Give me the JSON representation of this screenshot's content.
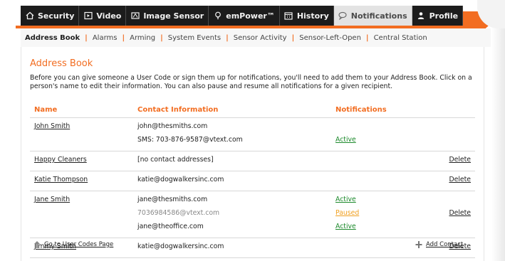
{
  "tabs": [
    {
      "label": "Security",
      "icon": "home-icon",
      "active": false
    },
    {
      "label": "Video",
      "icon": "video-icon",
      "active": false
    },
    {
      "label": "Image Sensor",
      "icon": "image-sensor-icon",
      "active": false
    },
    {
      "label": "emPower™",
      "icon": "bulb-icon",
      "active": false
    },
    {
      "label": "History",
      "icon": "calendar-icon",
      "active": false
    },
    {
      "label": "Notifications",
      "icon": "chat-bubble-icon",
      "active": true
    },
    {
      "label": "Profile",
      "icon": "person-icon",
      "active": false
    }
  ],
  "subnav": [
    {
      "label": "Address Book",
      "active": true
    },
    {
      "label": "Alarms",
      "active": false
    },
    {
      "label": "Arming",
      "active": false
    },
    {
      "label": "System Events",
      "active": false
    },
    {
      "label": "Sensor Activity",
      "active": false
    },
    {
      "label": "Sensor-Left-Open",
      "active": false
    },
    {
      "label": "Central Station",
      "active": false
    }
  ],
  "subnav_separator": "|",
  "page": {
    "title": "Address Book",
    "intro": "Before you can give someone a User Code or sign them up for notifications, you'll need to add them to your Address Book. Click on a person's name to edit their information. You can also pause and resume all notifications for a given recipient."
  },
  "table": {
    "headers": {
      "name": "Name",
      "contact": "Contact Information",
      "notifications": "Notifications"
    },
    "rows": [
      {
        "name": "John Smith",
        "contacts": [
          "john@thesmiths.com",
          "SMS: 703-876-9587@vtext.com"
        ],
        "notifications": [
          "",
          "Active"
        ],
        "delete": ""
      },
      {
        "name": "Happy Cleaners",
        "contacts": [
          "[no contact addresses]"
        ],
        "notifications": [
          ""
        ],
        "delete": "Delete"
      },
      {
        "name": "Katie Thompson",
        "contacts": [
          "katie@dogwalkersinc.com"
        ],
        "notifications": [
          ""
        ],
        "delete": "Delete"
      },
      {
        "name": "Jane Smith",
        "contacts": [
          "jane@thesmiths.com",
          "7036984586@vtext.com",
          "jane@theoffice.com"
        ],
        "notifications": [
          "Active",
          "Paused",
          "Active"
        ],
        "delete": "Delete"
      },
      {
        "name": "Jimmy Smith",
        "contacts": [
          "katie@dogwalkersinc.com"
        ],
        "notifications": [
          ""
        ],
        "delete": "Delete"
      }
    ]
  },
  "footer": {
    "go_to_user_codes": "Go to User Codes Page",
    "add_contact": "Add Contact"
  },
  "colors": {
    "accent": "#f26d21",
    "active": "#1d8a2c",
    "paused": "#f0a020",
    "tab_bg": "#1c1c1c"
  }
}
